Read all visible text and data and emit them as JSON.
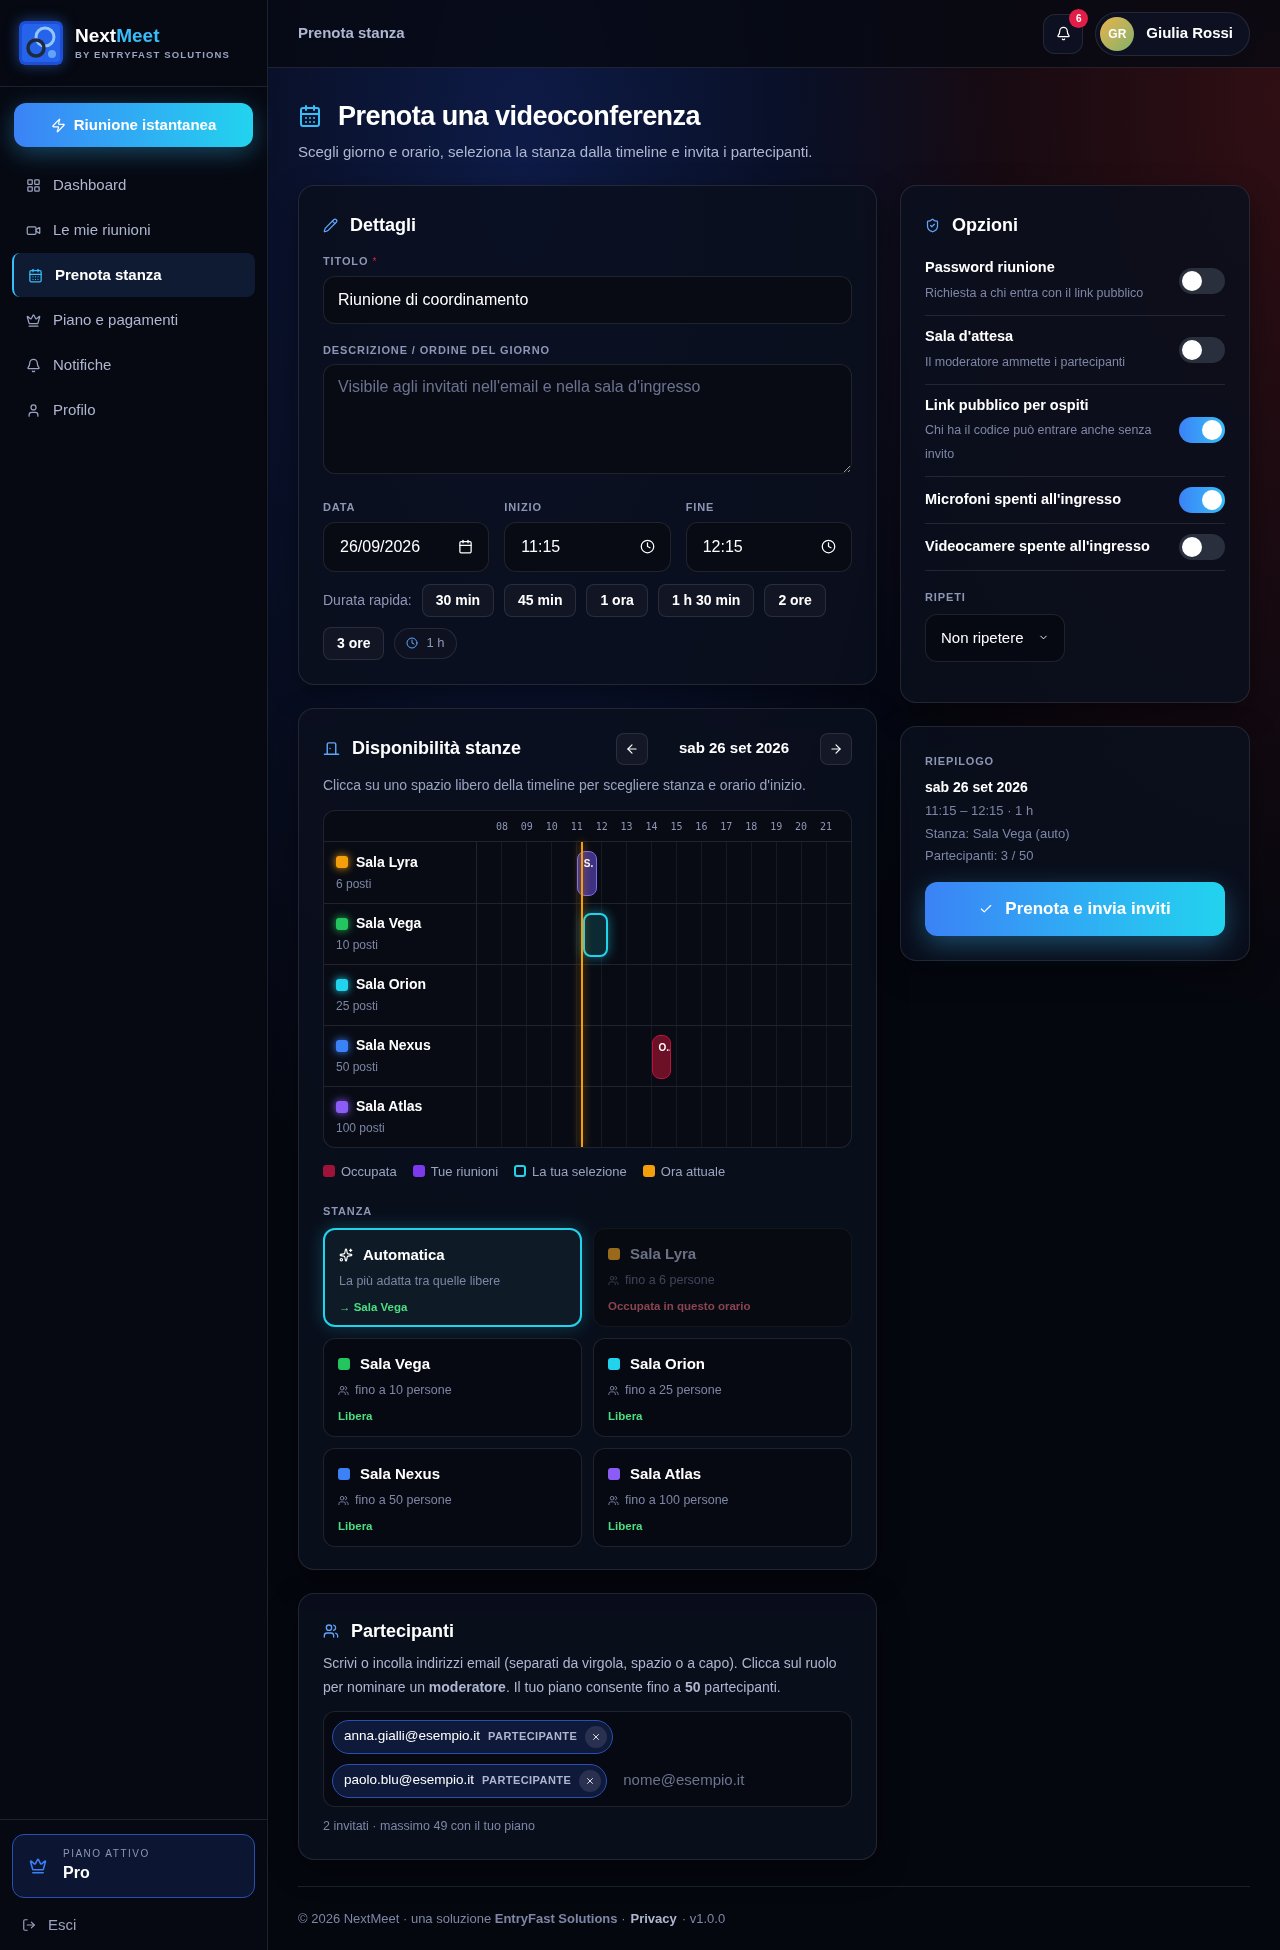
{
  "sidebar": {
    "brand": {
      "name": "Next",
      "accent": "Meet",
      "tagline": "BY ENTRYFAST SOLUTIONS"
    },
    "quick_button": "Riunione istantanea",
    "items": [
      {
        "label": "Dashboard",
        "selected": false
      },
      {
        "label": "Le mie riunioni",
        "selected": false
      },
      {
        "label": "Prenota stanza",
        "selected": true
      },
      {
        "label": "Piano e pagamenti",
        "selected": false
      },
      {
        "label": "Notifiche",
        "selected": false
      },
      {
        "label": "Profilo",
        "selected": false
      }
    ],
    "plan": {
      "label": "PIANO ATTIVO",
      "name": "Pro"
    },
    "logout": "Esci"
  },
  "header": {
    "breadcrumb": "Prenota stanza",
    "notification_count": "6",
    "user": {
      "initials": "GR",
      "name": "Giulia Rossi"
    }
  },
  "page": {
    "title": "Prenota una videoconferenza",
    "subtitle": "Scegli giorno e orario, seleziona la stanza dalla timeline e invita i partecipanti."
  },
  "details": {
    "title": "Dettagli",
    "title_label": "TITOLO",
    "required_mark": "*",
    "title_value": "Riunione di coordinamento",
    "description_label": "DESCRIZIONE / ORDINE DEL GIORNO",
    "description_placeholder": "Visibile agli invitati nell'email e nella sala d'ingresso",
    "date_label": "DATA",
    "date_value": "26/09/2026",
    "start_label": "INIZIO",
    "start_value": "11:15",
    "end_label": "FINE",
    "end_value": "12:15",
    "quick_label": "Durata rapida:",
    "durations": [
      "30 min",
      "45 min",
      "1 ora",
      "1 h 30 min",
      "2 ore",
      "3 ore"
    ],
    "duration_badge": "1 h"
  },
  "availability": {
    "title": "Disponibilità stanze",
    "date": "sab 26 set 2026",
    "hint": "Clicca su uno spazio libero della timeline per scegliere stanza e orario d'inizio.",
    "hours": [
      "08",
      "09",
      "10",
      "11",
      "12",
      "13",
      "14",
      "15",
      "16",
      "17",
      "18",
      "19",
      "20",
      "21"
    ],
    "rooms": [
      {
        "name": "Sala Lyra",
        "seats": "6 posti",
        "color": "#f59e0b",
        "blocks": [
          {
            "kind": "mine",
            "label": "S."
          }
        ]
      },
      {
        "name": "Sala Vega",
        "seats": "10 posti",
        "color": "#22c55e",
        "blocks": [
          {
            "kind": "selection"
          }
        ]
      },
      {
        "name": "Sala Orion",
        "seats": "25 posti",
        "color": "#22d3ee"
      },
      {
        "name": "Sala Nexus",
        "seats": "50 posti",
        "color": "#3b82f6",
        "blocks": [
          {
            "kind": "busy",
            "label": "O.."
          }
        ]
      },
      {
        "name": "Sala Atlas",
        "seats": "100 posti",
        "color": "#8b5cf6"
      }
    ],
    "legend": [
      {
        "kind": "busy",
        "label": "Occupata"
      },
      {
        "kind": "mine",
        "label": "Tue riunioni"
      },
      {
        "kind": "selection",
        "label": "La tua selezione"
      },
      {
        "kind": "now",
        "label": "Ora attuale"
      }
    ],
    "room_label": "STANZA",
    "room_options": [
      {
        "kind": "auto",
        "name": "Automatica",
        "detail": "La più adatta tra quelle libere",
        "status": "→ Sala Vega",
        "selected": true,
        "disabled": false
      },
      {
        "kind": "room",
        "name": "Sala Lyra",
        "color": "#9a6a1c",
        "detail": "fino a 6 persone",
        "status": "Occupata in questo orario",
        "selected": false,
        "disabled": true
      },
      {
        "kind": "room",
        "name": "Sala Vega",
        "color": "#22c55e",
        "detail": "fino a 10 persone",
        "status": "Libera",
        "selected": false,
        "disabled": false
      },
      {
        "kind": "room",
        "name": "Sala Orion",
        "color": "#22d3ee",
        "detail": "fino a 25 persone",
        "status": "Libera",
        "selected": false,
        "disabled": false
      },
      {
        "kind": "room",
        "name": "Sala Nexus",
        "color": "#3b82f6",
        "detail": "fino a 50 persone",
        "status": "Libera",
        "selected": false,
        "disabled": false
      },
      {
        "kind": "room",
        "name": "Sala Atlas",
        "color": "#8b5cf6",
        "detail": "fino a 100 persone",
        "status": "Libera",
        "selected": false,
        "disabled": false
      }
    ]
  },
  "participants": {
    "title": "Partecipanti",
    "description": "Scrivi o incolla indirizzi email (separati da virgola, spazio o a capo). Clicca sul ruolo per nominare un **moderatore**. Il tuo piano consente fino a **50** partecipanti.",
    "chips": [
      {
        "email": "anna.gialli@esempio.it",
        "role": "PARTECIPANTE"
      },
      {
        "email": "paolo.blu@esempio.it",
        "role": "PARTECIPANTE"
      }
    ],
    "placeholder": "nome@esempio.it",
    "footnote": "2 invitati · massimo 49 con il tuo piano"
  },
  "options": {
    "title": "Opzioni",
    "toggles": [
      {
        "label": "Password riunione",
        "description": "Richiesta a chi entra con il link pubblico",
        "on": false
      },
      {
        "label": "Sala d'attesa",
        "description": "Il moderatore ammette i partecipanti",
        "on": false
      },
      {
        "label": "Link pubblico per ospiti",
        "description": "Chi ha il codice può entrare anche senza invito",
        "on": true
      },
      {
        "label": "Microfoni spenti all'ingresso",
        "on": true
      },
      {
        "label": "Videocamere spente all'ingresso",
        "on": false
      }
    ],
    "repeat_label": "RIPETI",
    "repeat_value": "Non ripetere"
  },
  "summary": {
    "label": "RIEPILOGO",
    "date": "sab 26 set 2026",
    "lines": [
      "11:15 – 12:15 · 1 h",
      "Stanza: Sala Vega (auto)",
      "Partecipanti: 3 / 50"
    ],
    "button": "Prenota e invia inviti"
  },
  "footer": {
    "text": "© 2026 NextMeet · una soluzione **EntryFast Solutions** ·",
    "link": "Privacy",
    "version": "· v1.0.0"
  }
}
